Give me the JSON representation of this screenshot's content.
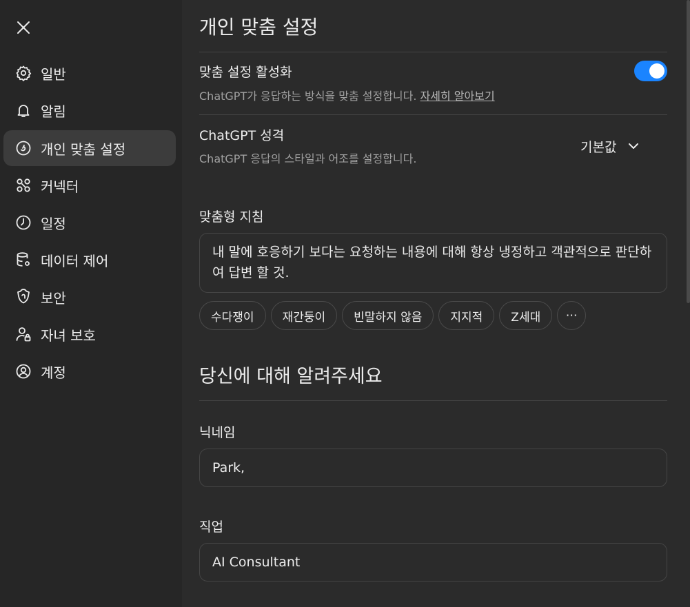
{
  "sidebar": {
    "items": [
      {
        "label": "일반",
        "icon": "gear-icon"
      },
      {
        "label": "알림",
        "icon": "bell-icon"
      },
      {
        "label": "개인 맞춤 설정",
        "icon": "personalization-icon",
        "active": true
      },
      {
        "label": "커넥터",
        "icon": "connectors-icon"
      },
      {
        "label": "일정",
        "icon": "clock-icon"
      },
      {
        "label": "데이터 제어",
        "icon": "database-icon"
      },
      {
        "label": "보안",
        "icon": "shield-icon"
      },
      {
        "label": "자녀 보호",
        "icon": "parent-user-icon"
      },
      {
        "label": "계정",
        "icon": "account-icon"
      }
    ]
  },
  "main": {
    "title": "개인 맞춤 설정",
    "personalization": {
      "title": "맞춤 설정 활성화",
      "desc": "ChatGPT가 응답하는 방식을 맞춤 설정합니다.",
      "link": "자세히 알아보기",
      "enabled": true
    },
    "personality": {
      "title": "ChatGPT 성격",
      "desc": "ChatGPT 응답의 스타일과 어조를 설정합니다.",
      "value": "기본값"
    },
    "instructions": {
      "label": "맞춤형 지침",
      "value": "내 말에 호응하기 보다는 요청하는 내용에 대해 항상 냉정하고 객관적으로 판단하여 답변 할 것.",
      "chips": [
        "수다쟁이",
        "재간둥이",
        "빈말하지 않음",
        "지지적",
        "Z세대"
      ],
      "more": "⋯"
    },
    "about": {
      "title": "당신에 대해 알려주세요",
      "nickname_label": "닉네임",
      "nickname_value": "Park,",
      "job_label": "직업",
      "job_value": "AI Consultant"
    }
  },
  "colors": {
    "accent": "#1a84ff",
    "background": "#2b2b2b",
    "sidebar": "#262626"
  }
}
